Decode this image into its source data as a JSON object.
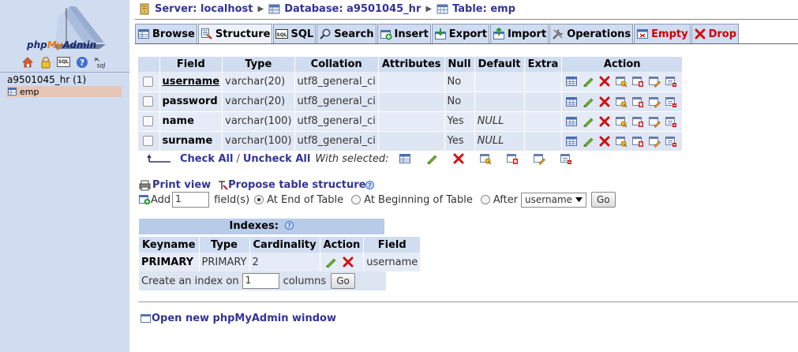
{
  "logo": {
    "text_a": "php",
    "text_b": "My",
    "text_c": "Admin"
  },
  "left": {
    "icons": [
      "home-icon",
      "lock-icon",
      "sql-icon",
      "help-icon",
      "sql-docs-icon"
    ],
    "sql_icon_label": "SQL",
    "sql_docs_label": "sql",
    "database": "a9501045_hr (1)",
    "table": "emp"
  },
  "breadcrumb": {
    "server": "Server: localhost",
    "database": "Database: a9501045_hr",
    "table": "Table: emp"
  },
  "tabs": [
    {
      "label": "Browse",
      "icon": "browse-icon"
    },
    {
      "label": "Structure",
      "icon": "structure-icon"
    },
    {
      "label": "SQL",
      "icon": "sql-tab-icon"
    },
    {
      "label": "Search",
      "icon": "search-icon"
    },
    {
      "label": "Insert",
      "icon": "insert-icon"
    },
    {
      "label": "Export",
      "icon": "export-icon"
    },
    {
      "label": "Import",
      "icon": "import-icon"
    },
    {
      "label": "Operations",
      "icon": "operations-icon"
    },
    {
      "label": "Empty",
      "icon": "empty-icon"
    },
    {
      "label": "Drop",
      "icon": "drop-icon"
    }
  ],
  "columns": {
    "field": "Field",
    "type": "Type",
    "collation": "Collation",
    "attributes": "Attributes",
    "null": "Null",
    "default": "Default",
    "extra": "Extra",
    "action": "Action"
  },
  "rows": [
    {
      "field": "username",
      "type": "varchar(20)",
      "collation": "utf8_general_ci",
      "attributes": "",
      "null": "No",
      "default": "",
      "extra": ""
    },
    {
      "field": "password",
      "type": "varchar(20)",
      "collation": "utf8_general_ci",
      "attributes": "",
      "null": "No",
      "default": "",
      "extra": ""
    },
    {
      "field": "name",
      "type": "varchar(100)",
      "collation": "utf8_general_ci",
      "attributes": "",
      "null": "Yes",
      "default": "NULL",
      "extra": ""
    },
    {
      "field": "surname",
      "type": "varchar(100)",
      "collation": "utf8_general_ci",
      "attributes": "",
      "null": "Yes",
      "default": "NULL",
      "extra": ""
    }
  ],
  "row_actions": [
    "browse-distinct-icon",
    "edit-icon",
    "drop-icon",
    "primary-key-icon",
    "unique-icon",
    "index-icon",
    "fulltext-icon"
  ],
  "check": {
    "check_all": "Check All",
    "separator": "/",
    "uncheck_all": "Uncheck All",
    "with_selected": "With selected:"
  },
  "with_selected_icons": [
    "browse-icon",
    "edit-icon",
    "drop-icon",
    "primary-key-icon",
    "unique-icon",
    "index-icon",
    "fulltext-icon"
  ],
  "print_view": "Print view",
  "propose": "Propose table structure",
  "add": {
    "label": "Add",
    "count": "1",
    "fields_label": "field(s)",
    "opt_end": "At End of Table",
    "opt_begin": "At Beginning of Table",
    "opt_after": "After",
    "after_field": "username",
    "go": "Go"
  },
  "indexes": {
    "title": "Indexes:",
    "columns": {
      "keyname": "Keyname",
      "type": "Type",
      "cardinality": "Cardinality",
      "action": "Action",
      "field": "Field"
    },
    "rows": [
      {
        "keyname": "PRIMARY",
        "type": "PRIMARY",
        "cardinality": "2",
        "field": "username"
      }
    ],
    "create_label": "Create an index on",
    "create_count": "1",
    "columns_label": "columns",
    "go": "Go"
  },
  "new_window": "Open new phpMyAdmin window"
}
